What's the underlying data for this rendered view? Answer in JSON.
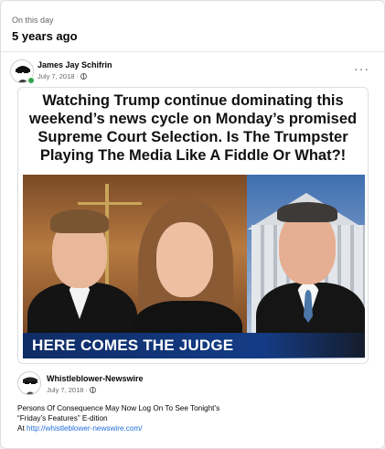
{
  "memory": {
    "label": "On this day",
    "years_ago": "5 years ago"
  },
  "post": {
    "author": "James Jay Schifrin",
    "date": "July 7, 2018",
    "separator": "·",
    "more_label": "···",
    "image": {
      "headline": "Watching Trump continue dominating this weekend’s news cycle on Monday’s promised Supreme Court Selection. Is The Trumpster Playing The Media Like A Fiddle Or What?!",
      "banner": "HERE COMES THE JUDGE"
    }
  },
  "shared": {
    "author": "Whistleblower-Newswire",
    "date": "July 7, 2018",
    "separator": "·",
    "text_line1": "Persons Of Consequence May Now Log On To See Tonight’s",
    "text_line2": "“Friday’s Features” E-dition",
    "text_prefix": "At ",
    "link": "http://whistleblower-newswire.com/"
  },
  "colors": {
    "online": "#31a24c",
    "link": "#216fdb",
    "banner": "#143c86"
  }
}
